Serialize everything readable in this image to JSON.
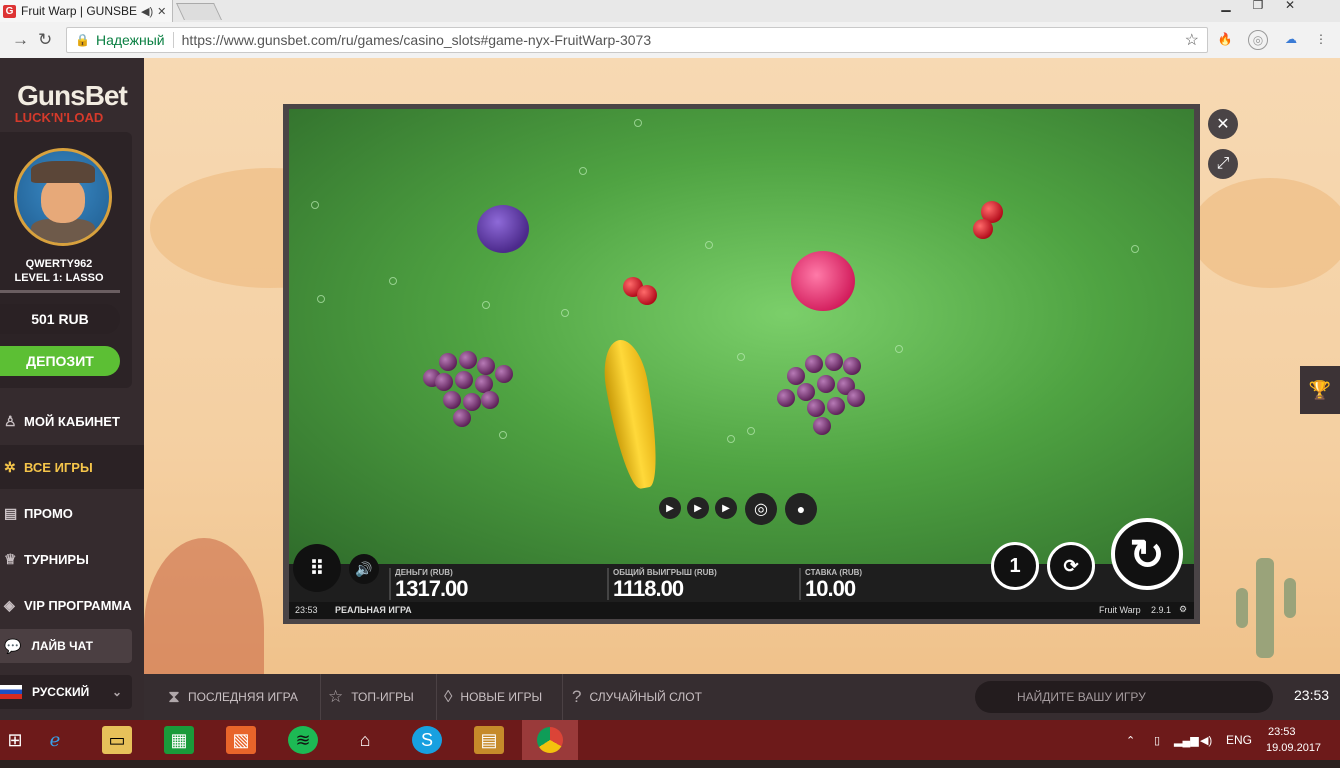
{
  "browser": {
    "tab_title": "Fruit Warp | GUNSBET",
    "tab_favicon": "G",
    "audio_icon": "speaker-icon",
    "secure_label": "Надежный",
    "url": "https://www.gunsbet.com/ru/games/casino_slots#game-nyx-FruitWarp-3073"
  },
  "sidebar": {
    "logo_top": "GunsBet",
    "logo_bottom": "LUCK'N'LOAD",
    "username": "QWERTY962",
    "level": "LEVEL 1: LASSO",
    "balance": "501 RUB",
    "deposit_label": "ДЕПОЗИТ",
    "menu": [
      {
        "label": "МОЙ КАБИНЕТ",
        "icon": "user-icon"
      },
      {
        "label": "ВСЕ ИГРЫ",
        "icon": "games-icon"
      },
      {
        "label": "ПРОМО",
        "icon": "promo-icon"
      },
      {
        "label": "ТУРНИРЫ",
        "icon": "trophy-icon"
      },
      {
        "label": "VIP ПРОГРАММА",
        "icon": "vip-icon"
      }
    ],
    "chat_label": "ЛАЙВ ЧАТ",
    "language": "РУССКИЙ"
  },
  "game": {
    "money_label": "ДЕНЬГИ (RUB)",
    "money_value": "1317.00",
    "win_label": "ОБЩИЙ ВЫИГРЫШ (RUB)",
    "win_value": "1118.00",
    "bet_label": "СТАВКА (RUB)",
    "bet_value": "10.00",
    "time": "23:53",
    "mode": "РЕАЛЬНАЯ ИГРА",
    "game_name": "Fruit Warp",
    "version": "2.9.1",
    "bet_level": "1"
  },
  "bottombar": {
    "items": [
      {
        "label": "ПОСЛЕДНЯЯ ИГРА",
        "icon": "hourglass-icon"
      },
      {
        "label": "ТОП-ИГРЫ",
        "icon": "star-icon"
      },
      {
        "label": "НОВЫЕ ИГРЫ",
        "icon": "drop-icon"
      },
      {
        "label": "СЛУЧАЙНЫЙ СЛОТ",
        "icon": "question-icon"
      }
    ],
    "search_placeholder": "НАЙДИТЕ ВАШУ ИГРУ",
    "clock": "23:53"
  },
  "taskbar": {
    "lang": "ENG",
    "time": "23:53",
    "date": "19.09.2017"
  }
}
